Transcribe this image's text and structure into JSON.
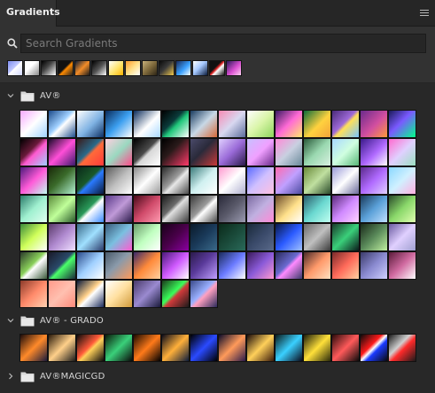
{
  "panel": {
    "tab_label": "Gradients",
    "menu_icon": "hamburger-menu-icon"
  },
  "search": {
    "placeholder": "Search Gradients",
    "value": "",
    "icon": "search-icon"
  },
  "recent": {
    "swatches": [
      "linear-gradient(135deg,#7d8cf0 0%,#c0c8ff 45%,#ffffff 50%,#d0d6ff 100%)",
      "linear-gradient(135deg,#ffffff 0%,#ffffff 40%,#8a8a8a 100%)",
      "linear-gradient(135deg,#000 0%,#444 40%,#fff 100%)",
      "linear-gradient(135deg,#111 0%,#111 45%,#ff8a00 55%,#222 100%)",
      "linear-gradient(135deg,#0b1e3a 0%,#f28c28 50%,#1b1b1b 100%)",
      "linear-gradient(135deg,#000 0%,#555 50%,#ffffff 100%)",
      "linear-gradient(135deg,#ffffff 0%,#ffe36a 55%,#ffb300 100%)",
      "linear-gradient(135deg,#ff9a2b 0%,#ffe08a 50%,#ffffff 100%)",
      "linear-gradient(135deg,#c7b07a 0%,#7f6a3c 50%,#2b2416 100%)",
      "linear-gradient(135deg,#0b0b0b 0%,#3a3a3a 45%,#f2c94c 100%)",
      "linear-gradient(135deg,#1b2a5a 0%,#3aa1ff 55%,#ffffff 100%)",
      "linear-gradient(135deg,#ffffff 0%,#a4c8ff 45%,#0a1a3a 100%)",
      "linear-gradient(135deg,#111 0%,#111 40%,#d22 50%,#fff 60%,#111 100%)",
      "linear-gradient(135deg,#2a1a5a 0%,#d94fd0 55%,#ffd1f2 100%)"
    ]
  },
  "groups": [
    {
      "name": "AV®",
      "expanded": true,
      "cells": [
        "linear-gradient(135deg,#f6a7ff 0%,#ffffff 50%,#9fd3ff 100%)",
        "linear-gradient(135deg,#1c4a8a 0%,#9fd0ff 45%,#ffffff 55%,#1e4d8e 100%)",
        "linear-gradient(135deg,#ffffff 0%,#7fb2e3 55%,#0d2f63 100%)",
        "linear-gradient(135deg,#0a2b5a 0%,#3c9ff0 50%,#ffffff 100%)",
        "linear-gradient(135deg,#0a2b5a 0%,#ffffff 55%,#a8d8ff 100%)",
        "linear-gradient(135deg,#000 0%,#0b3a3a 40%,#1fc77a 55%,#ffffff 100%)",
        "linear-gradient(135deg,#183a5e 0%,#c8d8e6 50%,#d66a3a 100%)",
        "linear-gradient(135deg,#f78bb4 0%,#d8d8f0 50%,#5a6b9a 100%)",
        "linear-gradient(135deg,#ffffff 0%,#d9f5a8 50%,#8dd45c 100%)",
        "linear-gradient(135deg,#3a1a63 0%,#ff6ad6 50%,#ffe86a 100%)",
        "linear-gradient(135deg,#0c6b3a 0%,#ffd23f 55%,#f2a23a 100%)",
        "linear-gradient(135deg,#4a2a7a 0%,#9e6ad8 45%,#ffe05a 55%,#79c6ff 100%)",
        "linear-gradient(135deg,#6a2a8a 0%,#d24fa0 55%,#ff9a3a 100%)",
        "linear-gradient(135deg,#1a1a5a 0%,#7a5aff 45%,#00ff8a 100%)",
        "linear-gradient(135deg,#000 0%,#6a1a3a 40%,#ff5ad0 55%,#9fd0ff 100%)",
        "linear-gradient(135deg,#1a0a2a 0%,#ff4fd8 50%,#3a1a6a 100%)",
        "linear-gradient(135deg,#3a1a1a 0%,#2a6a8a 45%,#ff6a3a 55%,#ff3a3a 100%)",
        "linear-gradient(135deg,#ffd0e0 0%,#9ad8c0 50%,#ff4a8a 100%)",
        "linear-gradient(135deg,#000 0%,#4a4a4a 45%,#d8d8d8 55%,#ffffff 100%)",
        "linear-gradient(135deg,#000 0%,#2a1a1a 40%,#ff3a6a 100%)",
        "linear-gradient(135deg,#4a4a6a 0%,#2a2a3a 45%,#c93a3a 100%)",
        "linear-gradient(135deg,#e0d0ff 0%,#9a6ad8 50%,#2a1a4a 100%)",
        "linear-gradient(135deg,#c8c0ff 0%,#f0a0ff 50%,#6a2a8a 100%)",
        "linear-gradient(135deg,#ff8ad8 0%,#c8d0e0 50%,#6a8a9a 100%)",
        "linear-gradient(135deg,#2a5a3a 0%,#9ad8b0 50%,#d8f0e0 100%)",
        "linear-gradient(135deg,#a8d8ff 0%,#d0ffe0 50%,#58b878 100%)",
        "linear-gradient(135deg,#3a1a8a 0%,#b06aff 55%,#ffffff 100%)",
        "linear-gradient(135deg,#ff6ad0 0%,#e0d0ff 50%,#9ae0c0 100%)",
        "linear-gradient(135deg,#4a1a7a 0%,#ff5ad8 50%,#c0fff0 100%)",
        "linear-gradient(135deg,#1a2a0a 0%,#3a6a2a 45%,#b0f0d0 100%)",
        "linear-gradient(135deg,#0a2a1a 0%,#1a5a2a 45%,#2a7aff 55%,#0a1a3a 100%)",
        "linear-gradient(135deg,#5a5a5a 0%,#bdbdbd 50%,#ffffff 100%)",
        "linear-gradient(135deg,#8a8a8a 0%,#ffffff 50%,#9a9a9a 100%)",
        "linear-gradient(135deg,#2a2a2a 0%,#9a9a9a 45%,#e8e8e8 55%,#4a4a4a 100%)",
        "linear-gradient(135deg,#3a7a7a 0%,#d0f0f0 50%,#ffffff 100%)",
        "linear-gradient(135deg,#ff9ad0 0%,#ffffff 50%,#b0b0d0 100%)",
        "linear-gradient(135deg,#5a6aff 0%,#d0c0ff 50%,#ffc0e0 100%)",
        "linear-gradient(135deg,#ff6ab0 0%,#c0a0ff 50%,#4a4aa0 100%)",
        "linear-gradient(135deg,#6a8a3a 0%,#c0e0a0 50%,#2a4a2a 100%)",
        "linear-gradient(135deg,#9a9ad8 0%,#ffffff 50%,#6a6a9a 100%)",
        "linear-gradient(135deg,#5a2a8a 0%,#b06aff 50%,#e0d0ff 100%)",
        "linear-gradient(135deg,#8ad8ff 0%,#d0f0ff 50%,#ffb0e0 100%)",
        "linear-gradient(135deg,#2a7a6a 0%,#a0f0d0 50%,#e0fff0 100%)",
        "linear-gradient(135deg,#5a8a3a 0%,#c0ff9a 50%,#2a5a2a 100%)",
        "linear-gradient(135deg,#0a3a1a 0%,#2a9a5a 45%,#ffffff 55%,#3a8aff 100%)",
        "linear-gradient(135deg,#5a3a8a 0%,#c09ad8 50%,#2a1a4a 100%)",
        "linear-gradient(135deg,#4a0a1a 0%,#d04a6a 50%,#ff9ab0 100%)",
        "linear-gradient(135deg,#1a1a1a 0%,#6a6a6a 40%,#e0e0e0 50%,#3a3a3a 100%)",
        "linear-gradient(135deg,#3a3a3a 0%,#9a9a9a 45%,#ffffff 55%,#4a4a4a 100%)",
        "linear-gradient(135deg,#2a2a3a 0%,#5a5a6a 50%,#9a9ab0 100%)",
        "linear-gradient(135deg,#7a6aa0 0%,#c0b0e0 50%,#ff8ad8 100%)",
        "linear-gradient(135deg,#6a4a2a 0%,#ffe08a 55%,#ffffff 100%)",
        "linear-gradient(135deg,#2a5a6a 0%,#6ad8d0 50%,#c0fff0 100%)",
        "linear-gradient(135deg,#5a2a7a 0%,#d08aff 50%,#ffd0ff 100%)",
        "linear-gradient(135deg,#1a3a5a 0%,#5aa0d8 50%,#c0e0ff 100%)",
        "linear-gradient(135deg,#2a4a2a 0%,#8ad86a 50%,#e0ffb0 100%)",
        "linear-gradient(135deg,#3a8a3a 0%,#d0ff5a 50%,#ffffff 100%)",
        "linear-gradient(135deg,#5a3a6a 0%,#b08ad0 50%,#f0e0ff 100%)",
        "linear-gradient(135deg,#3a6a8a 0%,#a0e0ff 50%,#2a3a6a 100%)",
        "linear-gradient(135deg,#3a5a7a 0%,#7ac0e0 50%,#ff5ad0 100%)",
        "linear-gradient(135deg,#6a9a6a 0%,#c0ffc0 50%,#ffffff 100%)",
        "linear-gradient(135deg,#1a001a 0%,#4a004a 50%,#8a00a0 100%)",
        "linear-gradient(135deg,#0a1a2a 0%,#1a3a5a 50%,#3a6a8a 100%)",
        "linear-gradient(135deg,#0a2a1a 0%,#1a4a3a 50%,#2a6a5a 100%)",
        "linear-gradient(135deg,#1a2a3a 0%,#3a4a6a 50%,#5a6a8a 100%)",
        "linear-gradient(135deg,#0a1a4a 0%,#2a5aff 50%,#a0c0ff 100%)",
        "linear-gradient(135deg,#6a6a6a 0%,#c0c0c0 50%,#3a3a3a 100%)",
        "linear-gradient(135deg,#1a3a2a 0%,#3ad07a 50%,#0a1a1a 100%)",
        "linear-gradient(135deg,#1a2a1a 0%,#5a8a5a 50%,#c0f0a0 100%)",
        "linear-gradient(135deg,#6a5aa0 0%,#e0d0ff 50%,#a0a0d0 100%)",
        "linear-gradient(135deg,#2a3a2a 0%,#8ad05a 45%,#ffffff 55%,#3a5a3a 100%)",
        "linear-gradient(135deg,#1a1a2a 0%,#2a4a6a 45%,#4aff6a 55%,#1a2a3a 100%)",
        "linear-gradient(135deg,#2a4a8a 0%,#a0d0ff 50%,#ffffff 100%)",
        "linear-gradient(135deg,#4a5a6a 0%,#8a9aaa 45%,#ff9a5a 100%)",
        "linear-gradient(135deg,#3a2a6a 0%,#ff8a3a 50%,#ffd0a0 100%)",
        "linear-gradient(135deg,#4a1a7a 0%,#d05aff 50%,#ffffff 100%)",
        "linear-gradient(135deg,#2a1a4a 0%,#5a3a9a 45%,#c0a0ff 100%)",
        "linear-gradient(135deg,#1a2a5a 0%,#6a7aff 50%,#ffffff 100%)",
        "linear-gradient(135deg,#3a1a5a 0%,#8a5ad8 50%,#ff9ad0 100%)",
        "linear-gradient(135deg,#2a2a5a 0%,#6a6ad0 45%,#ff8aff 55%,#3a3a6a 100%)",
        "linear-gradient(135deg,#4a2a2a 0%,#ff9a6a 50%,#ffe0c0 100%)",
        "linear-gradient(135deg,#7a2a2a 0%,#ff6a5a 50%,#ffd0a0 100%)",
        "linear-gradient(135deg,#3a3a6a 0%,#8a8ad0 50%,#d0d0ff 100%)",
        "linear-gradient(135deg,#5a1a3a 0%,#d06aa0 50%,#ffffff 100%)",
        "linear-gradient(135deg,#8a3a2a 0%,#ff8a6a 50%,#ffd0b0 100%)",
        "linear-gradient(135deg,#ff9a8a 0%,#ffc0b0 50%,#ff8a7a 100%)",
        "linear-gradient(135deg,#0a1a3a 0%,#ffd08a 45%,#ffffff 55%,#1a2a5a 100%)",
        "linear-gradient(135deg,#ffffff 0%,#ffe0a0 50%,#d09a3a 100%)",
        "linear-gradient(135deg,#4a3a6a 0%,#9a8ad0 50%,#1a1a3a 100%)",
        "linear-gradient(135deg,#1a3a1a 0%,#3aff5a 45%,#d03a3a 55%,#1a1a1a 100%)",
        "linear-gradient(135deg,#3a4a8a 0%,#9ab0ff 45%,#ffa0c0 55%,#2a2a5a 100%)"
      ]
    },
    {
      "name": "AV® - GRADO",
      "expanded": true,
      "cells": [
        "linear-gradient(135deg,#1a0a0a 0%,#ff8a2a 50%,#1a1a3a 100%)",
        "linear-gradient(135deg,#2a1a0a 0%,#ffd08a 50%,#1a1a1a 100%)",
        "linear-gradient(135deg,#0a0a0a 0%,#ff5a3a 45%,#ffd05a 55%,#0a0a0a 100%)",
        "linear-gradient(135deg,#0a1a0a 0%,#3ad07a 50%,#0a0a0a 100%)",
        "linear-gradient(135deg,#1a0a00 0%,#ff7a1a 50%,#000 100%)",
        "linear-gradient(135deg,#0a0a1a 0%,#ffb03a 50%,#0a1a3a 100%)",
        "linear-gradient(135deg,#000 0%,#2a4aff 50%,#000 100%)",
        "linear-gradient(135deg,#0a0a2a 0%,#ff9a5a 50%,#2a1a4a 100%)",
        "linear-gradient(135deg,#1a0a0a 0%,#ffd05a 50%,#3a1a0a 100%)",
        "linear-gradient(135deg,#0a1a1a 0%,#3ad0ff 50%,#0a0a1a 100%)",
        "linear-gradient(135deg,#1a1a0a 0%,#ffe03a 50%,#2a2a0a 100%)",
        "linear-gradient(135deg,#2a0a0a 0%,#ff5a5a 50%,#0a0a0a 100%)",
        "linear-gradient(135deg,#0a0a0a 0%,#ff1a1a 40%,#ffffff 50%,#1a3aff 60%,#0a0a0a 100%)",
        "linear-gradient(135deg,#1a1a1a 0%,#d0d0d0 40%,#ff2a2a 55%,#1a1a1a 100%)"
      ]
    },
    {
      "name": "AV®MAGICGD",
      "expanded": false,
      "cells": []
    }
  ]
}
